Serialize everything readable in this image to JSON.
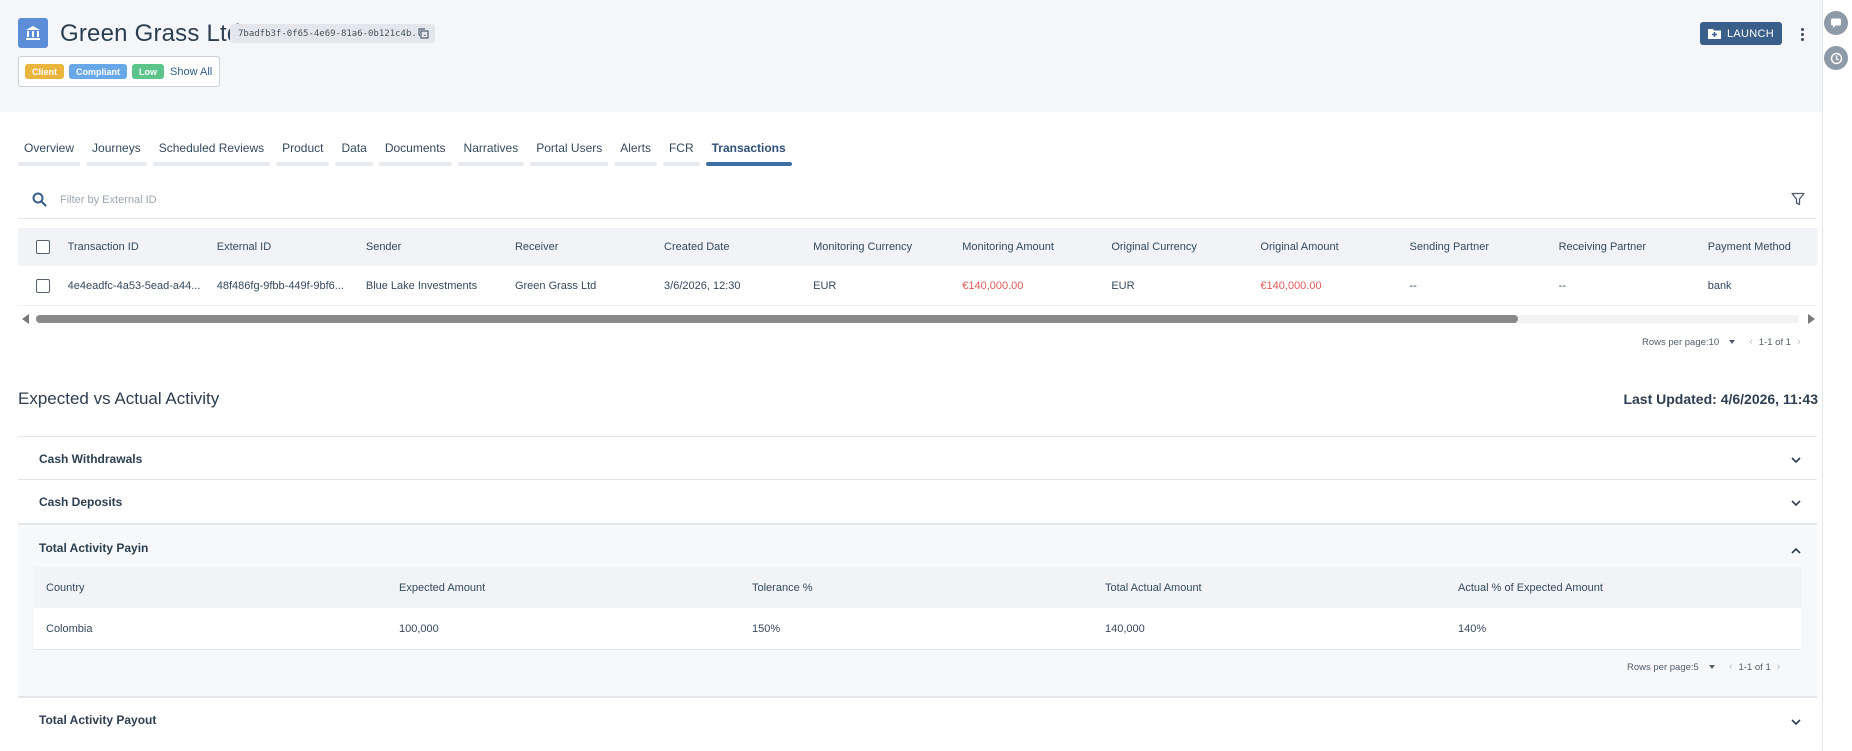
{
  "header": {
    "company_name": "Green Grass Ltd",
    "entity_id": "7badfb3f-0f65-4e69-81a6-0b121c4b...",
    "tags": [
      "Client",
      "Compliant",
      "Low"
    ],
    "show_all_label": "Show All",
    "launch_label": "LAUNCH"
  },
  "tabs": [
    {
      "label": "Overview"
    },
    {
      "label": "Journeys"
    },
    {
      "label": "Scheduled Reviews"
    },
    {
      "label": "Product"
    },
    {
      "label": "Data"
    },
    {
      "label": "Documents"
    },
    {
      "label": "Narratives"
    },
    {
      "label": "Portal Users"
    },
    {
      "label": "Alerts"
    },
    {
      "label": "FCR"
    },
    {
      "label": "Transactions",
      "active": true
    }
  ],
  "transactions": {
    "filter_placeholder": "Filter by External ID",
    "columns": [
      "Transaction ID",
      "External ID",
      "Sender",
      "Receiver",
      "Created Date",
      "Monitoring Currency",
      "Monitoring Amount",
      "Original Currency",
      "Original Amount",
      "Sending Partner",
      "Receiving Partner",
      "Payment Method"
    ],
    "rows": [
      [
        "4e4eadfc-4a53-5ead-a44...",
        "48f486fg-9fbb-449f-9bf6...",
        "Blue Lake Investments",
        "Green Grass Ltd",
        "3/6/2026, 12:30",
        "EUR",
        "€140,000.00",
        "EUR",
        "€140,000.00",
        "--",
        "--",
        "bank"
      ]
    ],
    "rows_per_page_label": "Rows per page:",
    "rows_per_page_value": "10",
    "range": "1-1 of 1"
  },
  "activity": {
    "title": "Expected vs Actual Activity",
    "last_updated_label": "Last Updated:",
    "last_updated_value": "4/6/2026, 11:43",
    "sections": [
      {
        "title": "Cash Withdrawals",
        "expanded": false
      },
      {
        "title": "Cash Deposits",
        "expanded": false
      },
      {
        "title": "Total Activity Payin",
        "expanded": true
      },
      {
        "title": "Total Activity Payout",
        "expanded": false
      }
    ],
    "payin_columns": [
      "Country",
      "Expected Amount",
      "Tolerance %",
      "Total Actual Amount",
      "Actual % of Expected Amount"
    ],
    "payin_rows": [
      [
        "Colombia",
        "100,000",
        "150%",
        "140,000",
        "140%"
      ]
    ],
    "rows_per_page_label": "Rows per page:",
    "rows_per_page_value": "5",
    "range": "1-1 of 1"
  },
  "colors": {
    "brand": "#3a5f8a",
    "accent_tab": "#3e6fa3",
    "client_tag": "#e9b53c",
    "compliant_tag": "#69a8e8",
    "low_tag": "#5cc48a",
    "amount_red": "#e05a55"
  },
  "icons": [
    "bank-icon",
    "copy-icon",
    "launch-icon",
    "kebab-menu-icon",
    "chat-icon",
    "history-icon",
    "search-icon",
    "filter-icon",
    "chevron-down-icon",
    "chevron-up-icon"
  ]
}
